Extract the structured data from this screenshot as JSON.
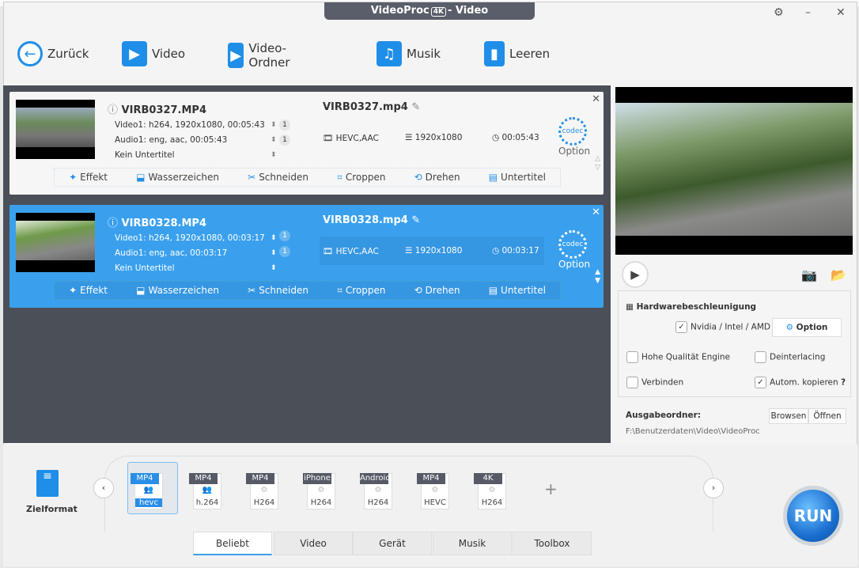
{
  "window": {
    "title": "VideoProc",
    "badge": "4K",
    "subtitle": "- Video"
  },
  "toolbar": {
    "back": "Zurück",
    "video": "Video",
    "folder": "Video-Ordner",
    "music": "Musik",
    "clear": "Leeren"
  },
  "files": [
    {
      "name": "VIRB0327.MP4",
      "video": "Video1: h264, 1920x1080, 00:05:43",
      "audio": "Audio1: eng, aac, 00:05:43",
      "subtitle": "Kein Untertitel",
      "video_track": "1",
      "audio_track": "1",
      "output_name": "VIRB0327.mp4",
      "codec": "HEVC,AAC",
      "resolution": "1920x1080",
      "duration": "00:05:43",
      "codec_icon": "codec",
      "option": "Option"
    },
    {
      "name": "VIRB0328.MP4",
      "video": "Video1: h264, 1920x1080, 00:03:17",
      "audio": "Audio1: eng, aac, 00:03:17",
      "subtitle": "Kein Untertitel",
      "video_track": "1",
      "audio_track": "1",
      "output_name": "VIRB0328.mp4",
      "codec": "HEVC,AAC",
      "resolution": "1920x1080",
      "duration": "00:03:17",
      "codec_icon": "codec",
      "option": "Option"
    }
  ],
  "edit_tools": [
    "Effekt",
    "Wasserzeichen",
    "Schneiden",
    "Croppen",
    "Drehen",
    "Untertitel"
  ],
  "settings": {
    "hw_title": "Hardwarebeschleunigung",
    "hw_option": "Nvidia / Intel / AMD",
    "option_btn": "Option",
    "high_quality": "Hohe Qualität Engine",
    "deinterlacing": "Deinterlacing",
    "merge": "Verbinden",
    "auto_copy": "Autom. kopieren",
    "help": "?",
    "output_label": "Ausgabeordner:",
    "browse": "Browsen",
    "open": "Öffnen",
    "output_path": "F:\\Benutzerdaten\\Video\\VideoProc"
  },
  "bottom": {
    "target_label": "Zielformat",
    "run": "RUN",
    "formats": [
      {
        "top": "MP4",
        "bottom": "hevc"
      },
      {
        "top": "MP4",
        "bottom": "h.264"
      },
      {
        "top": "MP4",
        "bottom": "H264"
      },
      {
        "top": "iPhone",
        "bottom": "H264"
      },
      {
        "top": "Android",
        "bottom": "H264"
      },
      {
        "top": "MP4",
        "bottom": "HEVC"
      },
      {
        "top": "4K",
        "bottom": "H264"
      }
    ],
    "add": "+",
    "tabs": [
      "Beliebt",
      "Video",
      "Gerät",
      "Musik",
      "Toolbox"
    ]
  },
  "colors": {
    "accent": "#3aa0ee",
    "panel": "#4b4f58"
  }
}
